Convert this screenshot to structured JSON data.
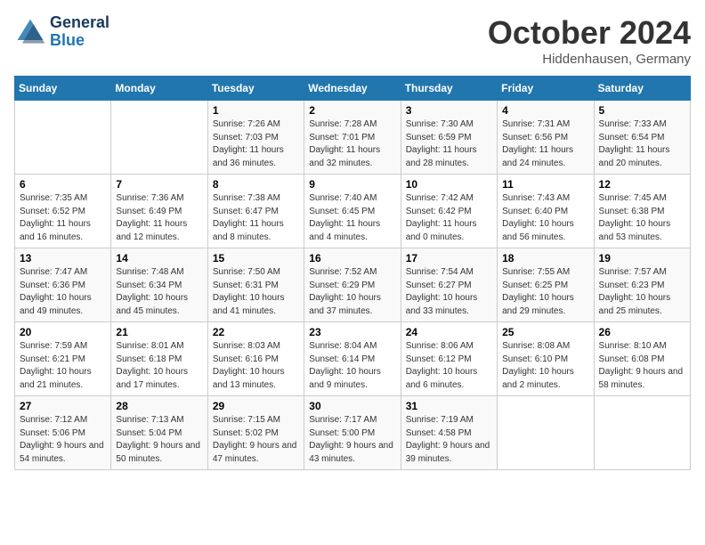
{
  "header": {
    "logo_line1": "General",
    "logo_line2": "Blue",
    "month": "October 2024",
    "location": "Hiddenhausen, Germany"
  },
  "weekdays": [
    "Sunday",
    "Monday",
    "Tuesday",
    "Wednesday",
    "Thursday",
    "Friday",
    "Saturday"
  ],
  "weeks": [
    [
      {
        "day": null
      },
      {
        "day": null
      },
      {
        "day": "1",
        "sunrise": "Sunrise: 7:26 AM",
        "sunset": "Sunset: 7:03 PM",
        "daylight": "Daylight: 11 hours and 36 minutes."
      },
      {
        "day": "2",
        "sunrise": "Sunrise: 7:28 AM",
        "sunset": "Sunset: 7:01 PM",
        "daylight": "Daylight: 11 hours and 32 minutes."
      },
      {
        "day": "3",
        "sunrise": "Sunrise: 7:30 AM",
        "sunset": "Sunset: 6:59 PM",
        "daylight": "Daylight: 11 hours and 28 minutes."
      },
      {
        "day": "4",
        "sunrise": "Sunrise: 7:31 AM",
        "sunset": "Sunset: 6:56 PM",
        "daylight": "Daylight: 11 hours and 24 minutes."
      },
      {
        "day": "5",
        "sunrise": "Sunrise: 7:33 AM",
        "sunset": "Sunset: 6:54 PM",
        "daylight": "Daylight: 11 hours and 20 minutes."
      }
    ],
    [
      {
        "day": "6",
        "sunrise": "Sunrise: 7:35 AM",
        "sunset": "Sunset: 6:52 PM",
        "daylight": "Daylight: 11 hours and 16 minutes."
      },
      {
        "day": "7",
        "sunrise": "Sunrise: 7:36 AM",
        "sunset": "Sunset: 6:49 PM",
        "daylight": "Daylight: 11 hours and 12 minutes."
      },
      {
        "day": "8",
        "sunrise": "Sunrise: 7:38 AM",
        "sunset": "Sunset: 6:47 PM",
        "daylight": "Daylight: 11 hours and 8 minutes."
      },
      {
        "day": "9",
        "sunrise": "Sunrise: 7:40 AM",
        "sunset": "Sunset: 6:45 PM",
        "daylight": "Daylight: 11 hours and 4 minutes."
      },
      {
        "day": "10",
        "sunrise": "Sunrise: 7:42 AM",
        "sunset": "Sunset: 6:42 PM",
        "daylight": "Daylight: 11 hours and 0 minutes."
      },
      {
        "day": "11",
        "sunrise": "Sunrise: 7:43 AM",
        "sunset": "Sunset: 6:40 PM",
        "daylight": "Daylight: 10 hours and 56 minutes."
      },
      {
        "day": "12",
        "sunrise": "Sunrise: 7:45 AM",
        "sunset": "Sunset: 6:38 PM",
        "daylight": "Daylight: 10 hours and 53 minutes."
      }
    ],
    [
      {
        "day": "13",
        "sunrise": "Sunrise: 7:47 AM",
        "sunset": "Sunset: 6:36 PM",
        "daylight": "Daylight: 10 hours and 49 minutes."
      },
      {
        "day": "14",
        "sunrise": "Sunrise: 7:48 AM",
        "sunset": "Sunset: 6:34 PM",
        "daylight": "Daylight: 10 hours and 45 minutes."
      },
      {
        "day": "15",
        "sunrise": "Sunrise: 7:50 AM",
        "sunset": "Sunset: 6:31 PM",
        "daylight": "Daylight: 10 hours and 41 minutes."
      },
      {
        "day": "16",
        "sunrise": "Sunrise: 7:52 AM",
        "sunset": "Sunset: 6:29 PM",
        "daylight": "Daylight: 10 hours and 37 minutes."
      },
      {
        "day": "17",
        "sunrise": "Sunrise: 7:54 AM",
        "sunset": "Sunset: 6:27 PM",
        "daylight": "Daylight: 10 hours and 33 minutes."
      },
      {
        "day": "18",
        "sunrise": "Sunrise: 7:55 AM",
        "sunset": "Sunset: 6:25 PM",
        "daylight": "Daylight: 10 hours and 29 minutes."
      },
      {
        "day": "19",
        "sunrise": "Sunrise: 7:57 AM",
        "sunset": "Sunset: 6:23 PM",
        "daylight": "Daylight: 10 hours and 25 minutes."
      }
    ],
    [
      {
        "day": "20",
        "sunrise": "Sunrise: 7:59 AM",
        "sunset": "Sunset: 6:21 PM",
        "daylight": "Daylight: 10 hours and 21 minutes."
      },
      {
        "day": "21",
        "sunrise": "Sunrise: 8:01 AM",
        "sunset": "Sunset: 6:18 PM",
        "daylight": "Daylight: 10 hours and 17 minutes."
      },
      {
        "day": "22",
        "sunrise": "Sunrise: 8:03 AM",
        "sunset": "Sunset: 6:16 PM",
        "daylight": "Daylight: 10 hours and 13 minutes."
      },
      {
        "day": "23",
        "sunrise": "Sunrise: 8:04 AM",
        "sunset": "Sunset: 6:14 PM",
        "daylight": "Daylight: 10 hours and 9 minutes."
      },
      {
        "day": "24",
        "sunrise": "Sunrise: 8:06 AM",
        "sunset": "Sunset: 6:12 PM",
        "daylight": "Daylight: 10 hours and 6 minutes."
      },
      {
        "day": "25",
        "sunrise": "Sunrise: 8:08 AM",
        "sunset": "Sunset: 6:10 PM",
        "daylight": "Daylight: 10 hours and 2 minutes."
      },
      {
        "day": "26",
        "sunrise": "Sunrise: 8:10 AM",
        "sunset": "Sunset: 6:08 PM",
        "daylight": "Daylight: 9 hours and 58 minutes."
      }
    ],
    [
      {
        "day": "27",
        "sunrise": "Sunrise: 7:12 AM",
        "sunset": "Sunset: 5:06 PM",
        "daylight": "Daylight: 9 hours and 54 minutes."
      },
      {
        "day": "28",
        "sunrise": "Sunrise: 7:13 AM",
        "sunset": "Sunset: 5:04 PM",
        "daylight": "Daylight: 9 hours and 50 minutes."
      },
      {
        "day": "29",
        "sunrise": "Sunrise: 7:15 AM",
        "sunset": "Sunset: 5:02 PM",
        "daylight": "Daylight: 9 hours and 47 minutes."
      },
      {
        "day": "30",
        "sunrise": "Sunrise: 7:17 AM",
        "sunset": "Sunset: 5:00 PM",
        "daylight": "Daylight: 9 hours and 43 minutes."
      },
      {
        "day": "31",
        "sunrise": "Sunrise: 7:19 AM",
        "sunset": "Sunset: 4:58 PM",
        "daylight": "Daylight: 9 hours and 39 minutes."
      },
      {
        "day": null
      },
      {
        "day": null
      }
    ]
  ]
}
